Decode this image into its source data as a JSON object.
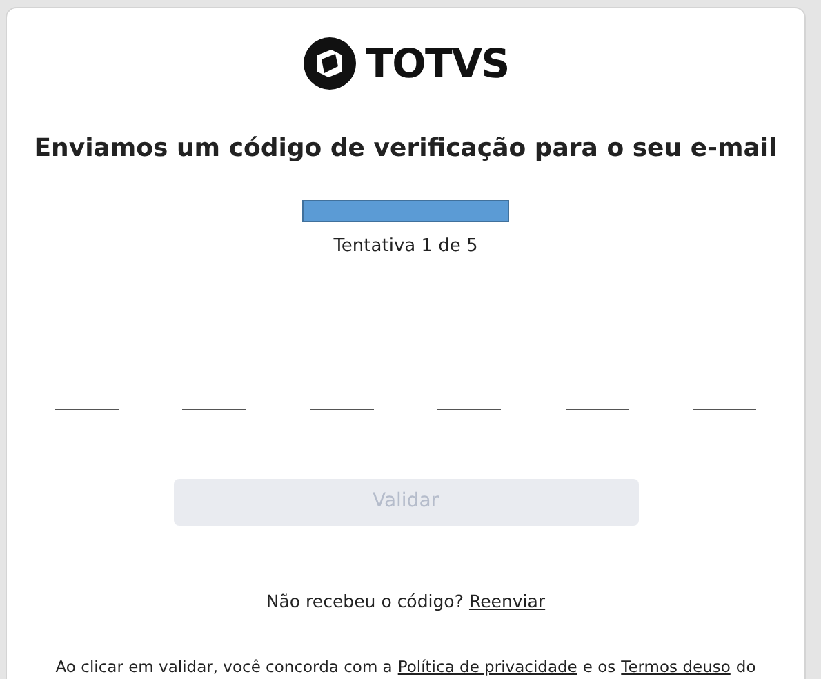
{
  "logo": {
    "text": "TOTVS"
  },
  "title": "Enviamos um código de verificação para o seu e-mail",
  "attempt": "Tentativa 1 de 5",
  "code_fields": [
    {
      "kind": "digit"
    },
    {
      "kind": "digit"
    },
    {
      "kind": "digit"
    },
    {
      "kind": "digit"
    },
    {
      "kind": "digit"
    },
    {
      "kind": "digit"
    }
  ],
  "validate_button": {
    "label": "Validar",
    "disabled": true
  },
  "resend": {
    "text": "Não recebeu o código?",
    "link": "Reenviar"
  },
  "terms": [
    {
      "kind": "text",
      "text": "Ao clicar em validar, você concorda com a"
    },
    {
      "kind": "link",
      "text": "Política de privacidade"
    },
    {
      "kind": "text",
      "text": "e os"
    },
    {
      "kind": "link",
      "text": "Termos deuso"
    },
    {
      "kind": "text",
      "text": "do"
    }
  ]
}
